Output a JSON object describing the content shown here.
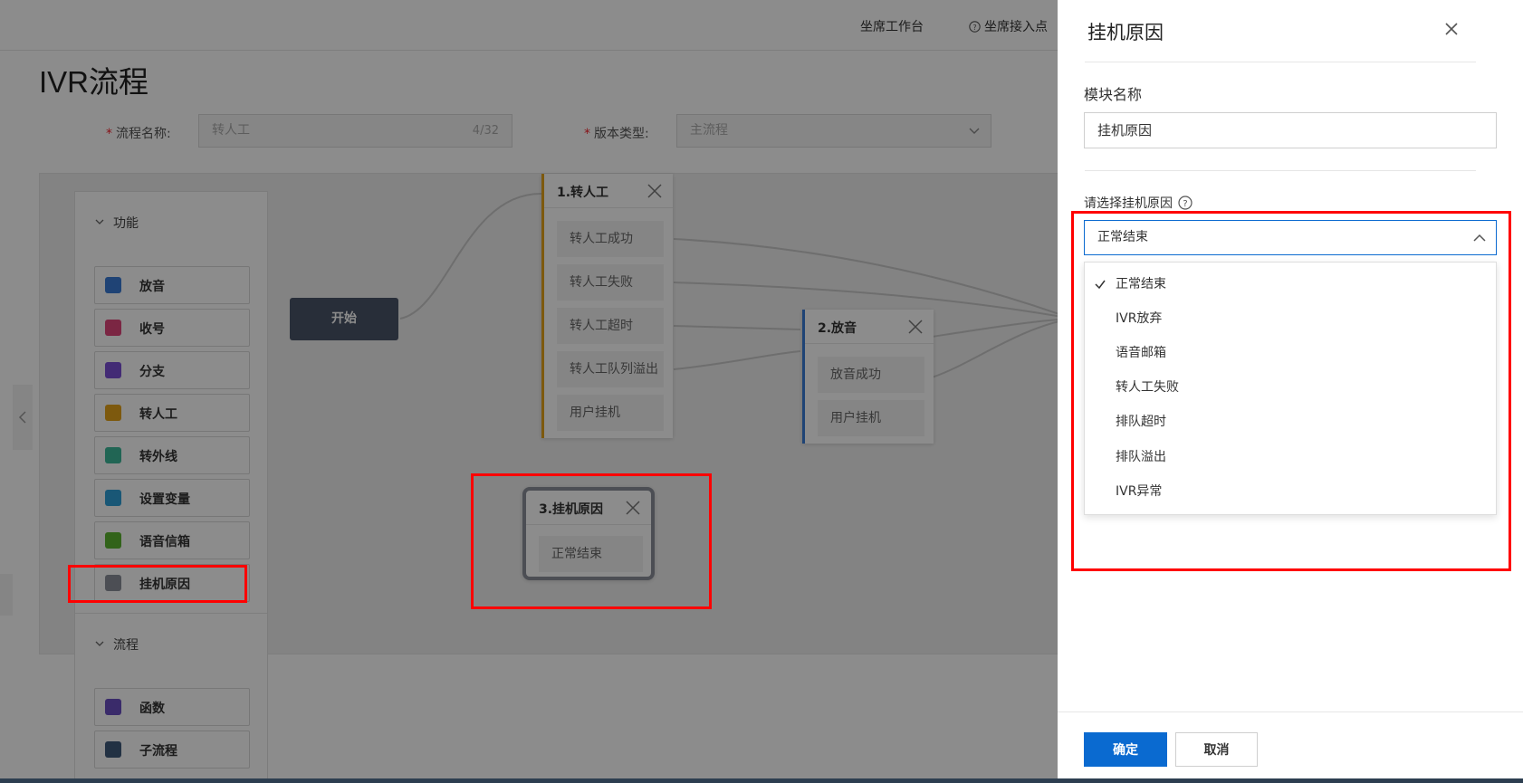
{
  "header": {
    "nav_agent_workbench": "坐席工作台",
    "nav_agent_access": "坐席接入点"
  },
  "page": {
    "title": "IVR流程",
    "flow_name_label": "流程名称:",
    "flow_name_value": "转人工",
    "flow_name_count": "4/32",
    "version_type_label": "版本类型:",
    "version_type_value": "主流程"
  },
  "palette": {
    "section_functions": "功能",
    "section_flow": "流程",
    "items": [
      {
        "label": "放音",
        "color": "#3a7bd5"
      },
      {
        "label": "收号",
        "color": "#e0457b"
      },
      {
        "label": "分支",
        "color": "#7b4fd6"
      },
      {
        "label": "转人工",
        "color": "#e3a21a"
      },
      {
        "label": "转外线",
        "color": "#3cb89a"
      },
      {
        "label": "设置变量",
        "color": "#2f9fd8"
      },
      {
        "label": "语音信箱",
        "color": "#5cb531"
      },
      {
        "label": "挂机原因",
        "color": "#8a8f99"
      }
    ],
    "flow_items": [
      {
        "label": "函数",
        "color": "#6a4fc2"
      },
      {
        "label": "子流程",
        "color": "#3f5a7a"
      }
    ]
  },
  "canvas": {
    "start_label": "开始",
    "node1": {
      "title": "1.转人工",
      "ports": [
        "转人工成功",
        "转人工失败",
        "转人工超时",
        "转人工队列溢出",
        "用户挂机"
      ],
      "accent": "#e3a21a"
    },
    "node2": {
      "title": "2.放音",
      "ports": [
        "放音成功",
        "用户挂机"
      ],
      "accent": "#3a7bd5"
    },
    "node3": {
      "title": "3.挂机原因",
      "ports": [
        "正常结束"
      ],
      "accent": "#8a8f99"
    }
  },
  "drawer": {
    "title": "挂机原因",
    "module_name_label": "模块名称",
    "module_name_value": "挂机原因",
    "reason_label": "请选择挂机原因",
    "reason_selected": "正常结束",
    "options": [
      "正常结束",
      "IVR放弃",
      "语音邮箱",
      "转人工失败",
      "排队超时",
      "排队溢出",
      "IVR异常"
    ],
    "confirm_label": "确定",
    "cancel_label": "取消"
  },
  "colors": {
    "primary": "#0a6ad0",
    "highlight": "#ff0000"
  }
}
